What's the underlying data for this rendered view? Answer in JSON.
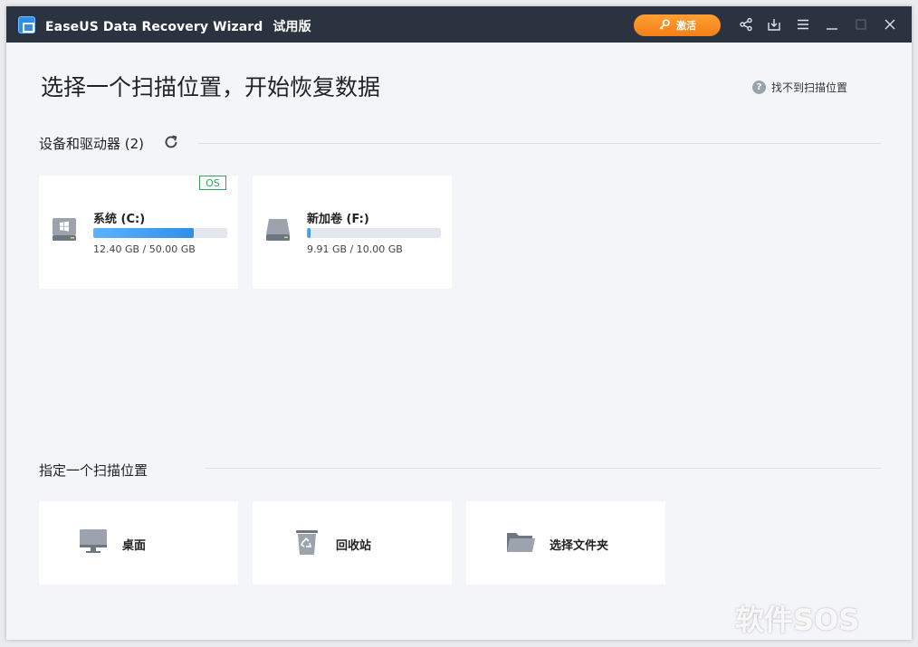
{
  "titlebar": {
    "app_name": "EaseUS Data Recovery Wizard",
    "edition": "试用版",
    "activate_label": "激活",
    "icons": [
      "share-icon",
      "download-icon",
      "menu-icon",
      "minimize-icon",
      "maximize-icon",
      "close-icon"
    ]
  },
  "main": {
    "title": "选择一个扫描位置，开始恢复数据",
    "help_link": "找不到扫描位置"
  },
  "devices": {
    "header": "设备和驱动器 (2)",
    "drives": [
      {
        "name": "系统 (C:)",
        "size_text": "12.40 GB / 50.00 GB",
        "used_fraction": 0.75,
        "badge": "OS",
        "icon": "windows-drive-icon"
      },
      {
        "name": "新加卷 (F:)",
        "size_text": "9.91 GB / 10.00 GB",
        "used_fraction": 0.03,
        "icon": "hard-drive-icon"
      }
    ]
  },
  "locations": {
    "header": "指定一个扫描位置",
    "items": [
      {
        "label": "桌面",
        "icon": "desktop-icon"
      },
      {
        "label": "回收站",
        "icon": "recycle-bin-icon"
      },
      {
        "label": "选择文件夹",
        "icon": "folder-icon"
      }
    ]
  },
  "colors": {
    "titlebar_bg": "#2b3340",
    "accent_orange": "#f7901e",
    "progress_blue": "#2f8fe6",
    "os_badge_green": "#33a65a"
  },
  "watermark": "软件SOS"
}
